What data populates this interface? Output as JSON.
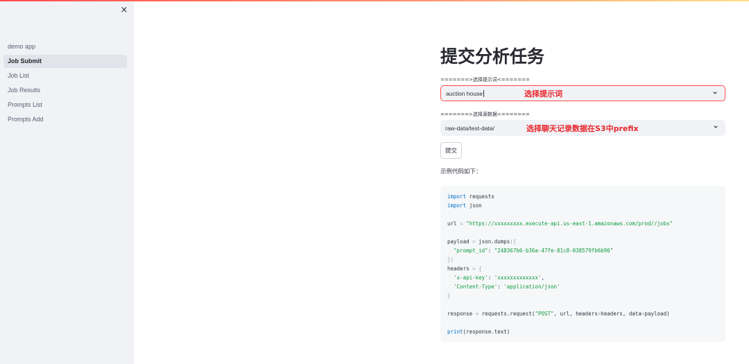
{
  "sidebar": {
    "close_glyph": "×",
    "items": [
      {
        "label": "demo app",
        "active": false
      },
      {
        "label": "Job Submit",
        "active": true
      },
      {
        "label": "Job List",
        "active": false
      },
      {
        "label": "Job Results",
        "active": false
      },
      {
        "label": "Prompts List",
        "active": false
      },
      {
        "label": "Prompts Add",
        "active": false
      }
    ]
  },
  "main": {
    "title": "提交分析任务",
    "prompt_select": {
      "label": "=======>选择提示词<=======",
      "value": "auction house",
      "annotation": "选择提示词"
    },
    "source_select": {
      "label": "=======>选择源数据<=======",
      "value": "raw-data/test-data/",
      "annotation": "选择聊天记录数据在S3中prefix"
    },
    "submit_label": "提交",
    "example_label": "示例代码如下：",
    "code": {
      "import1_kw": "import",
      "import1_mod": " requests",
      "import2_kw": "import",
      "import2_mod": " json",
      "url_var": "url ",
      "url_eq": "=",
      "url_val": " \"https://xxxxxxxxx.execute-api.us-east-1.amazonaws.com/prod//jobs\"",
      "payload_start": "payload ",
      "payload_eq": "=",
      "payload_call": " json.dumps",
      "payload_open": "({",
      "prompt_key": "  \"prompt_id\"",
      "prompt_colon": ": ",
      "prompt_val": "\"248367b6-b36a-47fe-81c8-038579fb6b96\"",
      "payload_close": "})",
      "headers_start": "headers ",
      "headers_eq": "=",
      "headers_open": " {",
      "apikey_key": "  'x-api-key'",
      "apikey_colon": ": ",
      "apikey_val": "'xxxxxxxxxxxxx'",
      "apikey_comma": ",",
      "ct_key": "  'Content-Type'",
      "ct_colon": ": ",
      "ct_val": "'application/json'",
      "headers_close": "}",
      "resp_start": "response ",
      "resp_eq": "=",
      "resp_call": " requests.request(",
      "resp_method": "\"POST\"",
      "resp_rest1": ", url, headers",
      "resp_eq2": "=",
      "resp_rest2": "headers, data",
      "resp_eq3": "=",
      "resp_rest3": "payload)",
      "print_kw": "print",
      "print_rest": "(response.text)"
    }
  },
  "colors": {
    "accent": "#ff4b4b",
    "annotation": "#e8262b",
    "sidebar_bg": "#f0f2f6"
  },
  "icons": {
    "close": "close-icon",
    "dropdown": "chevron-down-icon"
  }
}
